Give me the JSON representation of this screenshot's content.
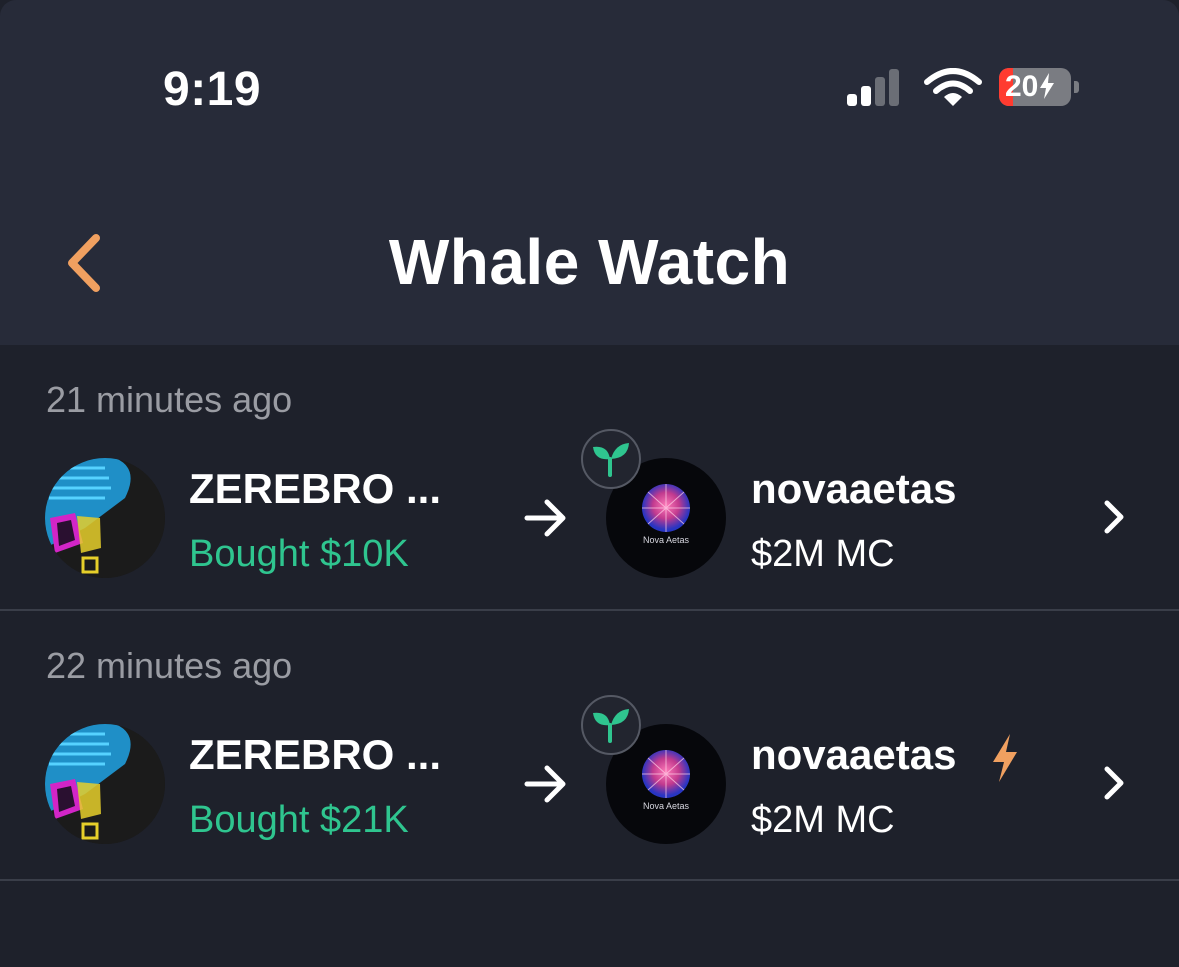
{
  "status_bar": {
    "time": "9:19",
    "battery_percent": "20",
    "battery_level": 0.2,
    "icons": [
      "cellular-signal-icon",
      "wifi-icon",
      "battery-icon",
      "charging-bolt-icon"
    ]
  },
  "header": {
    "title": "Whale Watch",
    "back_icon": "chevron-left-icon",
    "accent_color": "#f0a060"
  },
  "colors": {
    "background": "#1e212b",
    "header_background": "#272b39",
    "bought_green": "#2fc58f",
    "timestamp_gray": "#9a9ca3",
    "bolt_orange": "#f0a060"
  },
  "trades": [
    {
      "timestamp": "21 minutes ago",
      "whale_name": "ZEREBRO ...",
      "action": "Bought $10K",
      "token_name": "novaaetas",
      "market_cap": "$2M MC",
      "token_avatar_text": "Nova Aetas",
      "badge_icon": "sprout-icon",
      "has_bolt": false
    },
    {
      "timestamp": "22 minutes ago",
      "whale_name": "ZEREBRO ...",
      "action": "Bought $21K",
      "token_name": "novaaetas",
      "market_cap": "$2M MC",
      "token_avatar_text": "Nova Aetas",
      "badge_icon": "sprout-icon",
      "has_bolt": true
    }
  ]
}
